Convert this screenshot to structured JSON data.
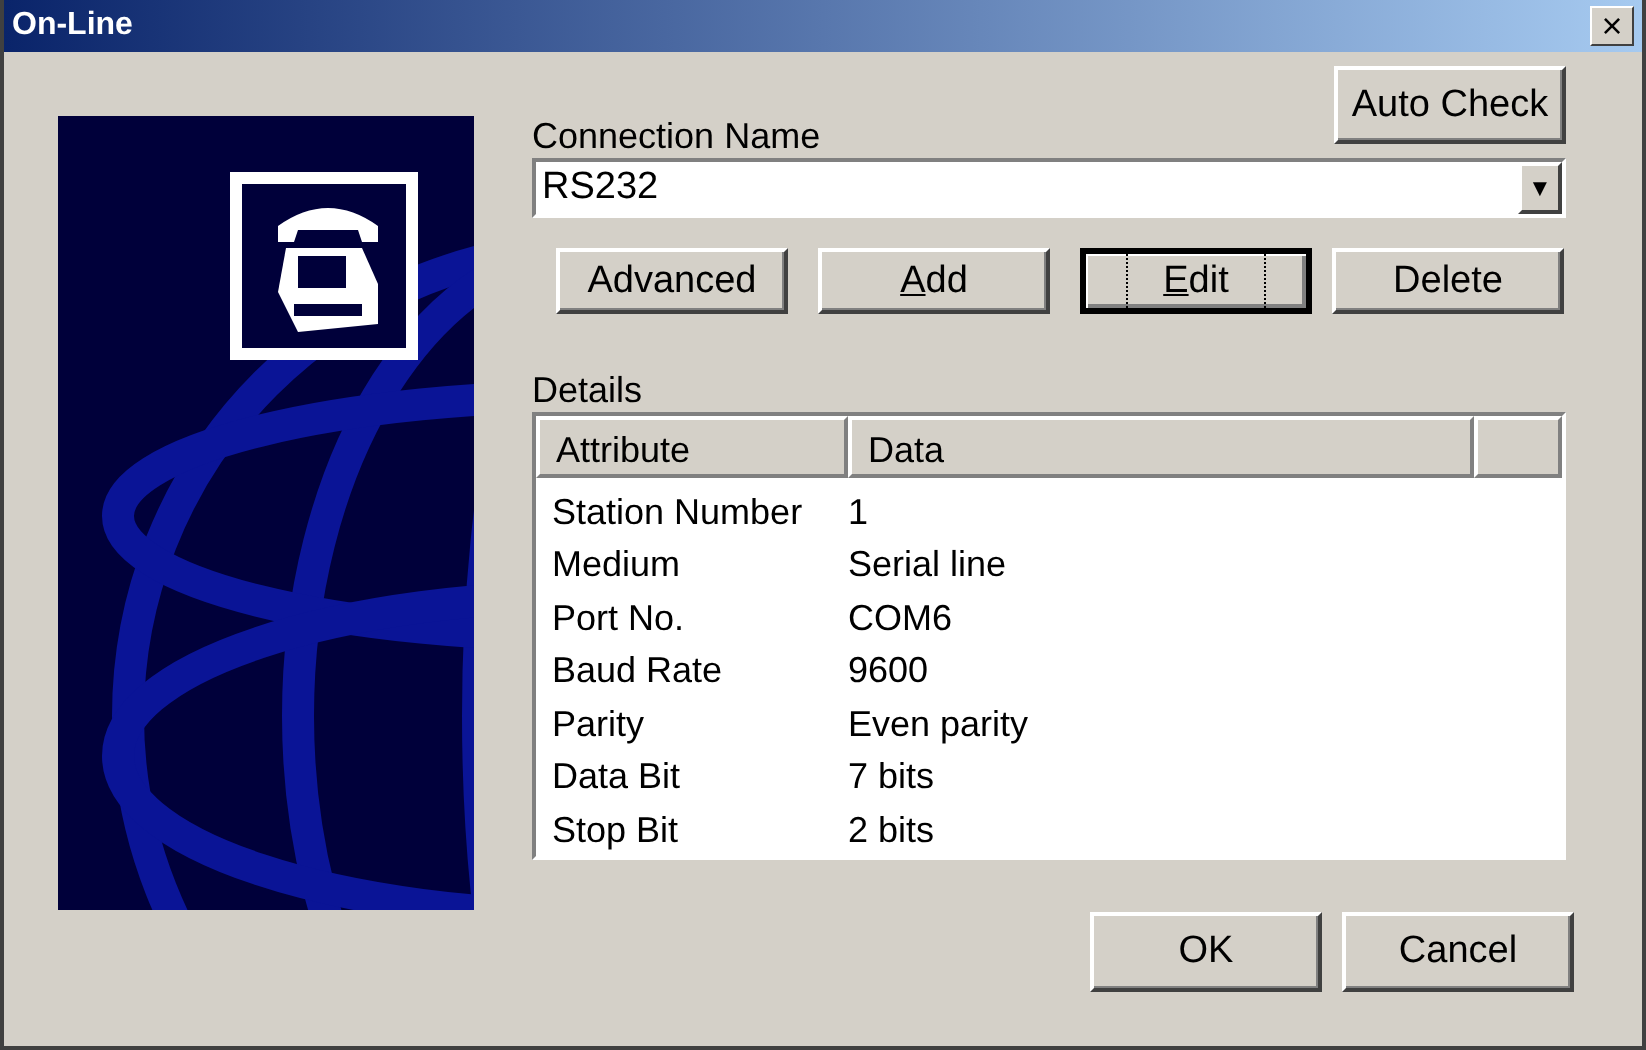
{
  "window": {
    "title": "On-Line",
    "close": "×"
  },
  "auto_check": {
    "label": "Auto Check",
    "default": false,
    "mnemonic": false
  },
  "connection": {
    "label": "Connection Name",
    "value": "RS232",
    "arrow": "▼"
  },
  "buttons": [
    {
      "label": "Advanced",
      "default": false,
      "mnemonic": false
    },
    {
      "label": "Add",
      "default": false,
      "mnemonic": true
    },
    {
      "label": "Edit",
      "default": true,
      "mnemonic": true
    },
    {
      "label": "Delete",
      "default": false,
      "mnemonic": false
    }
  ],
  "details": {
    "label": "Details",
    "columns": [
      "Attribute",
      "Data"
    ],
    "rows": [
      {
        "attribute": "Station Number",
        "data": "1"
      },
      {
        "attribute": "Medium",
        "data": "Serial line"
      },
      {
        "attribute": "Port No.",
        "data": "COM6"
      },
      {
        "attribute": "Baud Rate",
        "data": "9600"
      },
      {
        "attribute": "Parity",
        "data": "Even parity"
      },
      {
        "attribute": "Data Bit",
        "data": "7 bits"
      },
      {
        "attribute": "Stop Bit",
        "data": "2 bits"
      }
    ]
  },
  "footer_buttons": [
    {
      "label": "OK",
      "default": false,
      "mnemonic": false
    },
    {
      "label": "Cancel",
      "default": false,
      "mnemonic": false
    }
  ]
}
